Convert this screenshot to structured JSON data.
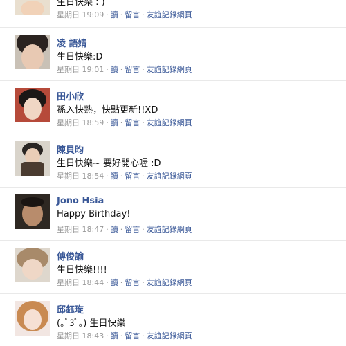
{
  "colors": {
    "link": "#3b5998",
    "meta": "#999999",
    "text": "#111111",
    "divider": "#e9e9e9"
  },
  "actions": {
    "read": "讀",
    "comment": "留言",
    "wall_to_wall": "友誼記錄網頁"
  },
  "posts": [
    {
      "name": "",
      "message": "生日快樂 : )",
      "time": "星期日 19:09"
    },
    {
      "name": "凌 語婧",
      "message": "生日快樂:D",
      "time": "星期日 19:01"
    },
    {
      "name": "田小欣",
      "message": "孫入快熟，快點更新!!XD",
      "time": "星期日 18:59"
    },
    {
      "name": "陳貝昀",
      "message": "生日快樂~ 要好開心喔 :D",
      "time": "星期日 18:54"
    },
    {
      "name": "Jono Hsia",
      "message": "Happy Birthday!",
      "time": "星期日 18:47"
    },
    {
      "name": "傅俊諭",
      "message": "生日快樂!!!!",
      "time": "星期日 18:44"
    },
    {
      "name": "邱鈺琁",
      "message": "(｡ﾟ3ﾟ｡) 生日快樂",
      "time": "星期日 18:43"
    }
  ]
}
